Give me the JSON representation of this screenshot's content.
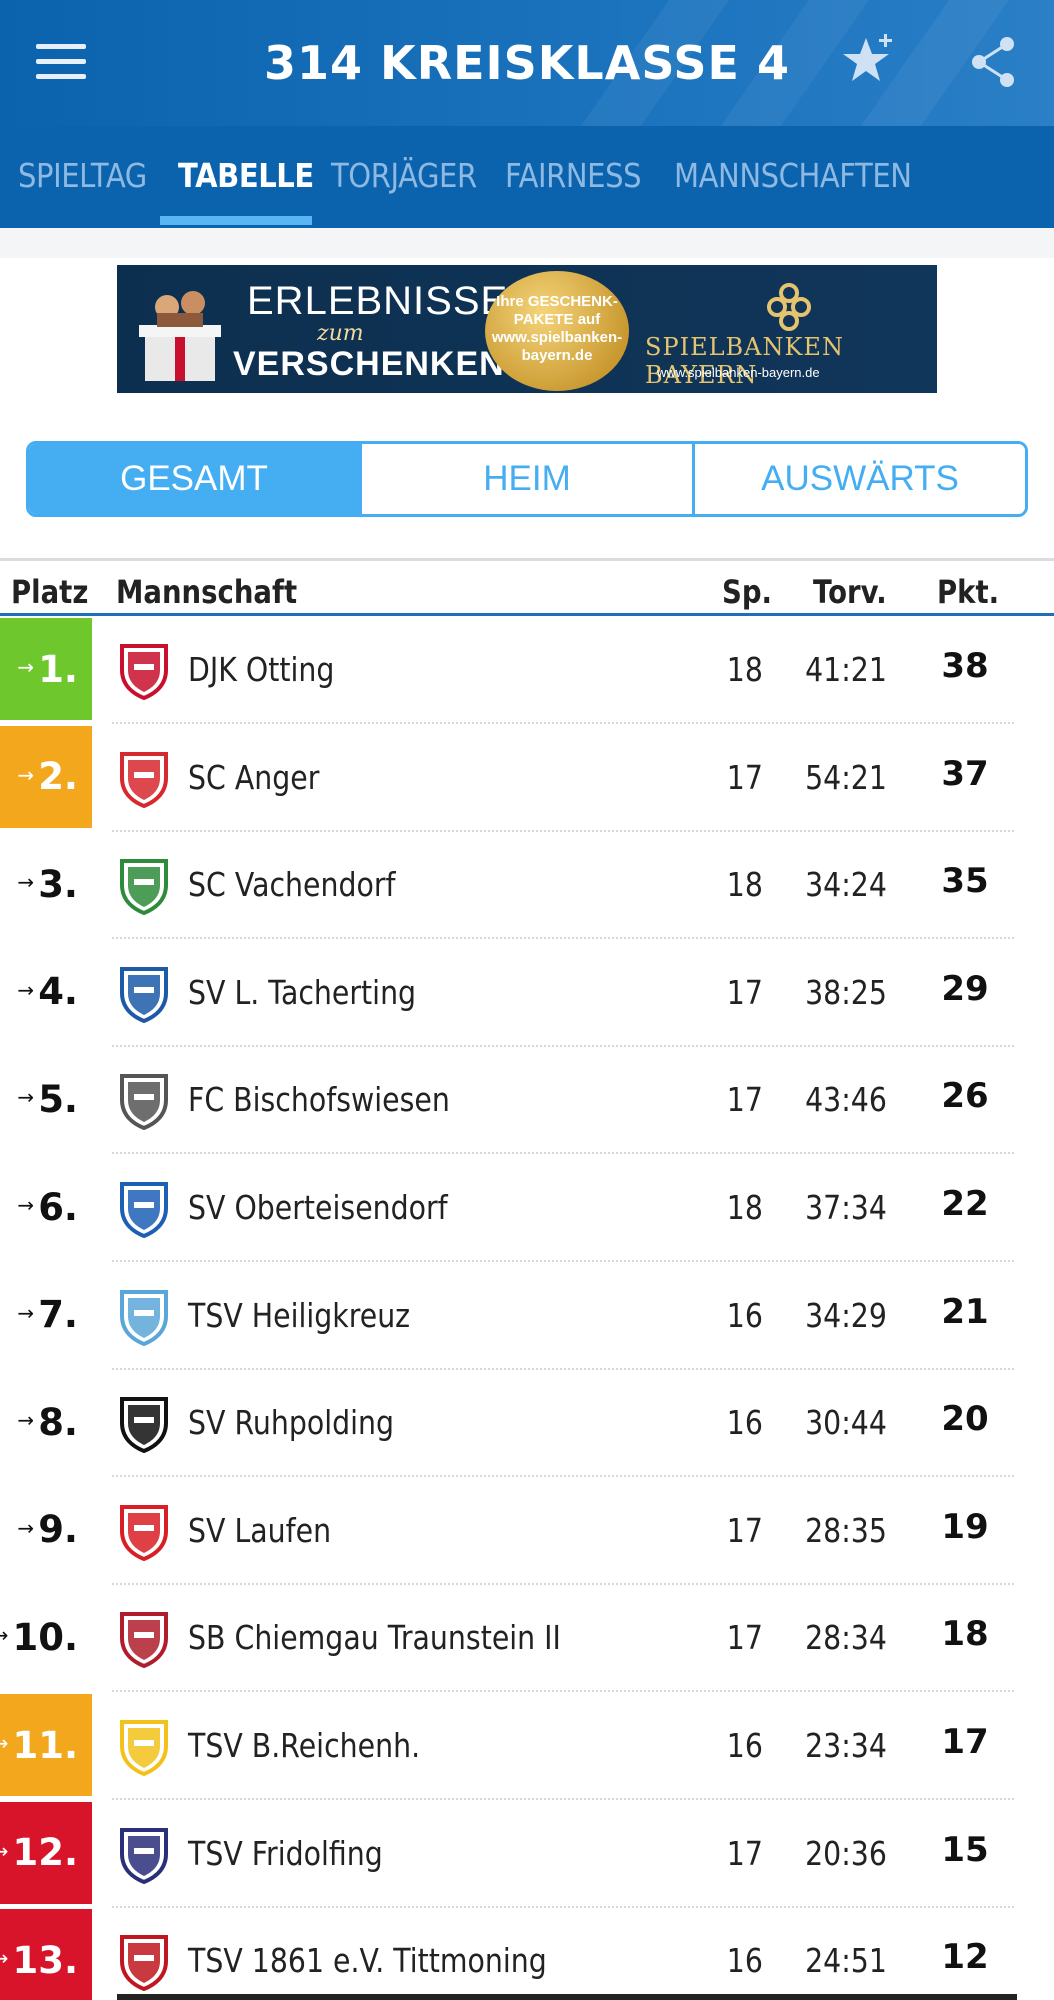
{
  "header": {
    "title": "314 KREISKLASSE 4",
    "menu_icon": "hamburger-menu-icon",
    "favorite_icon": "star-plus-icon",
    "share_icon": "share-icon"
  },
  "tabs": [
    {
      "label": "SPIELTAG",
      "active": false
    },
    {
      "label": "TABELLE",
      "active": true
    },
    {
      "label": "TORJÄGER",
      "active": false
    },
    {
      "label": "FAIRNESS",
      "active": false
    },
    {
      "label": "MANNSCHAFTEN",
      "active": false
    }
  ],
  "banner": {
    "line1": "ERLEBNISSE",
    "line2": "zum",
    "line3": "VERSCHENKEN",
    "badge": "Ihre GESCHENK-PAKETE auf www.spielbanken-bayern.de",
    "brand": "SPIELBANKEN BAYERN",
    "url": "www.spielbanken-bayern.de"
  },
  "filter": {
    "options": [
      "GESAMT",
      "HEIM",
      "AUSWÄRTS"
    ],
    "selected": "GESAMT"
  },
  "table": {
    "headers": {
      "place": "Platz",
      "team": "Mannschaft",
      "games": "Sp.",
      "goals": "Torv.",
      "points": "Pkt."
    },
    "rows": [
      {
        "place": "1.",
        "team": "DJK Otting",
        "games": "18",
        "goals": "41:21",
        "points": "38",
        "highlight": "promotion",
        "logo_color": "#c8102e"
      },
      {
        "place": "2.",
        "team": "SC Anger",
        "games": "17",
        "goals": "54:21",
        "points": "37",
        "highlight": "relegation",
        "logo_color": "#d6282f"
      },
      {
        "place": "3.",
        "team": "SC Vachendorf",
        "games": "18",
        "goals": "34:24",
        "points": "35",
        "highlight": "none",
        "logo_color": "#2e8b3a"
      },
      {
        "place": "4.",
        "team": "SV L. Tacherting",
        "games": "17",
        "goals": "38:25",
        "points": "29",
        "highlight": "none",
        "logo_color": "#1c5aa8"
      },
      {
        "place": "5.",
        "team": "FC Bischofswiesen",
        "games": "17",
        "goals": "43:46",
        "points": "26",
        "highlight": "none",
        "logo_color": "#555555"
      },
      {
        "place": "6.",
        "team": "SV Oberteisendorf",
        "games": "18",
        "goals": "37:34",
        "points": "22",
        "highlight": "none",
        "logo_color": "#1d5fb5"
      },
      {
        "place": "7.",
        "team": "TSV Heiligkreuz",
        "games": "16",
        "goals": "34:29",
        "points": "21",
        "highlight": "none",
        "logo_color": "#5aa6d8"
      },
      {
        "place": "8.",
        "team": "SV Ruhpolding",
        "games": "16",
        "goals": "30:44",
        "points": "20",
        "highlight": "none",
        "logo_color": "#111111"
      },
      {
        "place": "9.",
        "team": "SV Laufen",
        "games": "17",
        "goals": "28:35",
        "points": "19",
        "highlight": "none",
        "logo_color": "#d81f26"
      },
      {
        "place": "10.",
        "team": "SB Chiemgau Traunstein II",
        "games": "17",
        "goals": "28:34",
        "points": "18",
        "highlight": "none",
        "logo_color": "#b01e2d"
      },
      {
        "place": "11.",
        "team": "TSV  B.Reichenh.",
        "games": "16",
        "goals": "23:34",
        "points": "17",
        "highlight": "relegation",
        "logo_color": "#f2c21a"
      },
      {
        "place": "12.",
        "team": "TSV Fridolfing",
        "games": "17",
        "goals": "20:36",
        "points": "15",
        "highlight": "descent",
        "logo_color": "#2a2f7a"
      },
      {
        "place": "13.",
        "team": "TSV 1861 e.V. Tittmoning",
        "games": "16",
        "goals": "24:51",
        "points": "12",
        "highlight": "descent",
        "logo_color": "#c0161f"
      }
    ]
  },
  "colors": {
    "header_bg": "#0b63ad",
    "accent": "#45aef2",
    "promotion": "#6ec72d",
    "relegation": "#f2a71d",
    "descent": "#d8142a"
  }
}
